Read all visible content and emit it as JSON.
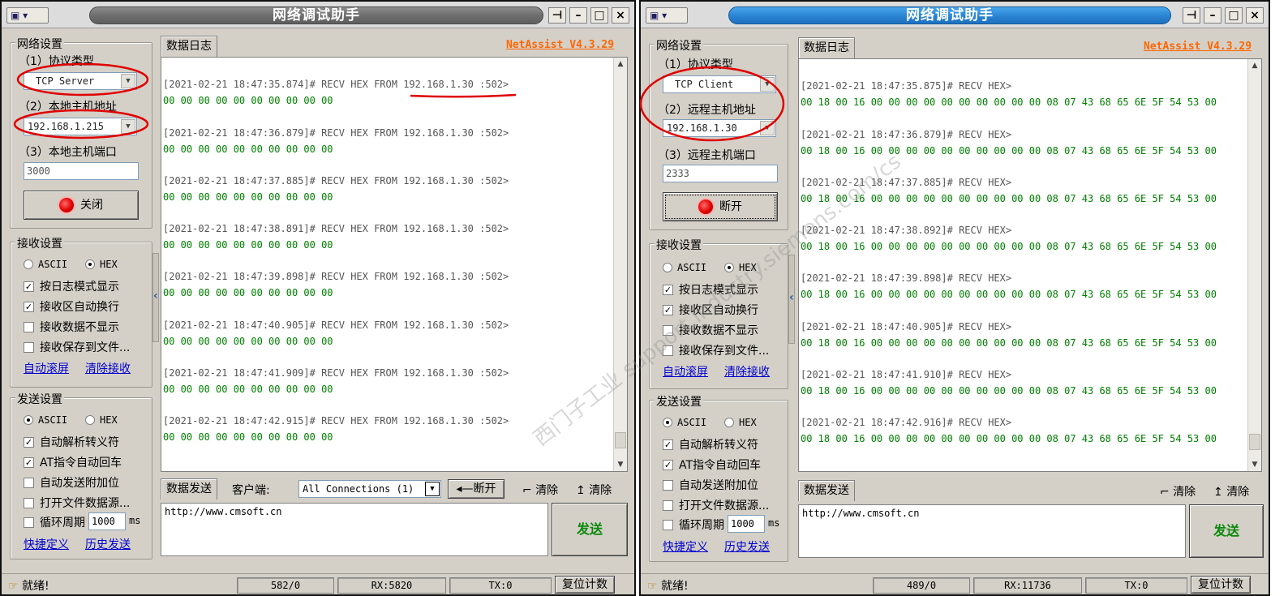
{
  "left": {
    "title": "网络调试助手",
    "brand": "NetAssist V4.3.29",
    "net": {
      "group": "网络设置",
      "protocol_label": "（1）协议类型",
      "protocol_value": "TCP Server",
      "addr_label": "（2）本地主机地址",
      "addr_value": "192.168.1.215",
      "port_label": "（3）本地主机端口",
      "port_value": "3000",
      "connect_button": "关闭"
    },
    "recv": {
      "group": "接收设置",
      "ascii": "ASCII",
      "hex": "HEX",
      "selected": "HEX",
      "options": [
        {
          "label": "按日志模式显示",
          "checked": true
        },
        {
          "label": "接收区自动换行",
          "checked": true
        },
        {
          "label": "接收数据不显示",
          "checked": false
        },
        {
          "label": "接收保存到文件...",
          "checked": false
        }
      ],
      "link_scroll": "自动滚屏",
      "link_clear": "清除接收"
    },
    "send": {
      "group": "发送设置",
      "ascii": "ASCII",
      "hex": "HEX",
      "selected": "ASCII",
      "options": [
        {
          "label": "自动解析转义符",
          "checked": true
        },
        {
          "label": "AT指令自动回车",
          "checked": true
        },
        {
          "label": "自动发送附加位",
          "checked": false
        },
        {
          "label": "打开文件数据源...",
          "checked": false
        }
      ],
      "cycle_label": "循环周期",
      "cycle_value": "1000",
      "cycle_unit": "ms",
      "link_shortcut": "快捷定义",
      "link_history": "历史发送"
    },
    "log_tab": "数据日志",
    "log": [
      {
        "ts": "[2021-02-21 18:47:35.874]# RECV HEX FROM 192.168.1.30 :502>",
        "data": "00 00 00 00 00 00 00 00 00 00"
      },
      {
        "ts": "[2021-02-21 18:47:36.879]# RECV HEX FROM 192.168.1.30 :502>",
        "data": "00 00 00 00 00 00 00 00 00 00"
      },
      {
        "ts": "[2021-02-21 18:47:37.885]# RECV HEX FROM 192.168.1.30 :502>",
        "data": "00 00 00 00 00 00 00 00 00 00"
      },
      {
        "ts": "[2021-02-21 18:47:38.891]# RECV HEX FROM 192.168.1.30 :502>",
        "data": "00 00 00 00 00 00 00 00 00 00"
      },
      {
        "ts": "[2021-02-21 18:47:39.898]# RECV HEX FROM 192.168.1.30 :502>",
        "data": "00 00 00 00 00 00 00 00 00 00"
      },
      {
        "ts": "[2021-02-21 18:47:40.905]# RECV HEX FROM 192.168.1.30 :502>",
        "data": "00 00 00 00 00 00 00 00 00 00"
      },
      {
        "ts": "[2021-02-21 18:47:41.909]# RECV HEX FROM 192.168.1.30 :502>",
        "data": "00 00 00 00 00 00 00 00 00 00"
      },
      {
        "ts": "[2021-02-21 18:47:42.915]# RECV HEX FROM 192.168.1.30 :502>",
        "data": "00 00 00 00 00 00 00 00 00 00"
      }
    ],
    "send_tab": "数据发送",
    "client_label": "客户端:",
    "client_value": "All Connections (1)",
    "disconnect_button": "断开",
    "clear1": "清除",
    "clear2": "清除",
    "send_text": "http://www.cmsoft.cn",
    "send_button": "发送",
    "status": {
      "ready": "就绪!",
      "count": "582/0",
      "rx": "RX:5820",
      "tx": "TX:0",
      "reset": "复位计数"
    }
  },
  "right": {
    "title": "网络调试助手",
    "brand": "NetAssist V4.3.29",
    "net": {
      "group": "网络设置",
      "protocol_label": "（1）协议类型",
      "protocol_value": "TCP Client",
      "addr_label": "（2）远程主机地址",
      "addr_value": "192.168.1.30",
      "port_label": "（3）远程主机端口",
      "port_value": "2333",
      "connect_button": "断开"
    },
    "recv": {
      "group": "接收设置",
      "ascii": "ASCII",
      "hex": "HEX",
      "selected": "HEX",
      "options": [
        {
          "label": "按日志模式显示",
          "checked": true
        },
        {
          "label": "接收区自动换行",
          "checked": true
        },
        {
          "label": "接收数据不显示",
          "checked": false
        },
        {
          "label": "接收保存到文件...",
          "checked": false
        }
      ],
      "link_scroll": "自动滚屏",
      "link_clear": "清除接收"
    },
    "send": {
      "group": "发送设置",
      "ascii": "ASCII",
      "hex": "HEX",
      "selected": "ASCII",
      "options": [
        {
          "label": "自动解析转义符",
          "checked": true
        },
        {
          "label": "AT指令自动回车",
          "checked": true
        },
        {
          "label": "自动发送附加位",
          "checked": false
        },
        {
          "label": "打开文件数据源...",
          "checked": false
        }
      ],
      "cycle_label": "循环周期",
      "cycle_value": "1000",
      "cycle_unit": "ms",
      "link_shortcut": "快捷定义",
      "link_history": "历史发送"
    },
    "log_tab": "数据日志",
    "log": [
      {
        "ts": "[2021-02-21 18:47:35.875]# RECV HEX>",
        "data": "00 18 00 16 00 00 00 00 00 00 00 00 00 00 08 07 43 68 65 6E 5F 54 53 00"
      },
      {
        "ts": "[2021-02-21 18:47:36.879]# RECV HEX>",
        "data": "00 18 00 16 00 00 00 00 00 00 00 00 00 00 08 07 43 68 65 6E 5F 54 53 00"
      },
      {
        "ts": "[2021-02-21 18:47:37.885]# RECV HEX>",
        "data": "00 18 00 16 00 00 00 00 00 00 00 00 00 00 08 07 43 68 65 6E 5F 54 53 00"
      },
      {
        "ts": "[2021-02-21 18:47:38.892]# RECV HEX>",
        "data": "00 18 00 16 00 00 00 00 00 00 00 00 00 00 08 07 43 68 65 6E 5F 54 53 00"
      },
      {
        "ts": "[2021-02-21 18:47:39.898]# RECV HEX>",
        "data": "00 18 00 16 00 00 00 00 00 00 00 00 00 00 08 07 43 68 65 6E 5F 54 53 00"
      },
      {
        "ts": "[2021-02-21 18:47:40.905]# RECV HEX>",
        "data": "00 18 00 16 00 00 00 00 00 00 00 00 00 00 08 07 43 68 65 6E 5F 54 53 00"
      },
      {
        "ts": "[2021-02-21 18:47:41.910]# RECV HEX>",
        "data": "00 18 00 16 00 00 00 00 00 00 00 00 00 00 08 07 43 68 65 6E 5F 54 53 00"
      },
      {
        "ts": "[2021-02-21 18:47:42.916]# RECV HEX>",
        "data": "00 18 00 16 00 00 00 00 00 00 00 00 00 00 08 07 43 68 65 6E 5F 54 53 00"
      }
    ],
    "send_tab": "数据发送",
    "clear1": "清除",
    "clear2": "清除",
    "send_text": "http://www.cmsoft.cn",
    "send_button": "发送",
    "status": {
      "ready": "就绪!",
      "count": "489/0",
      "rx": "RX:11736",
      "tx": "TX:0",
      "reset": "复位计数"
    }
  },
  "watermark": "西门子工业 support.industry.siemens.com/cs",
  "colors": {
    "hex_data": "#008000",
    "brand": "#ff6600",
    "annotation": "#e00000",
    "link": "#0000d0"
  }
}
